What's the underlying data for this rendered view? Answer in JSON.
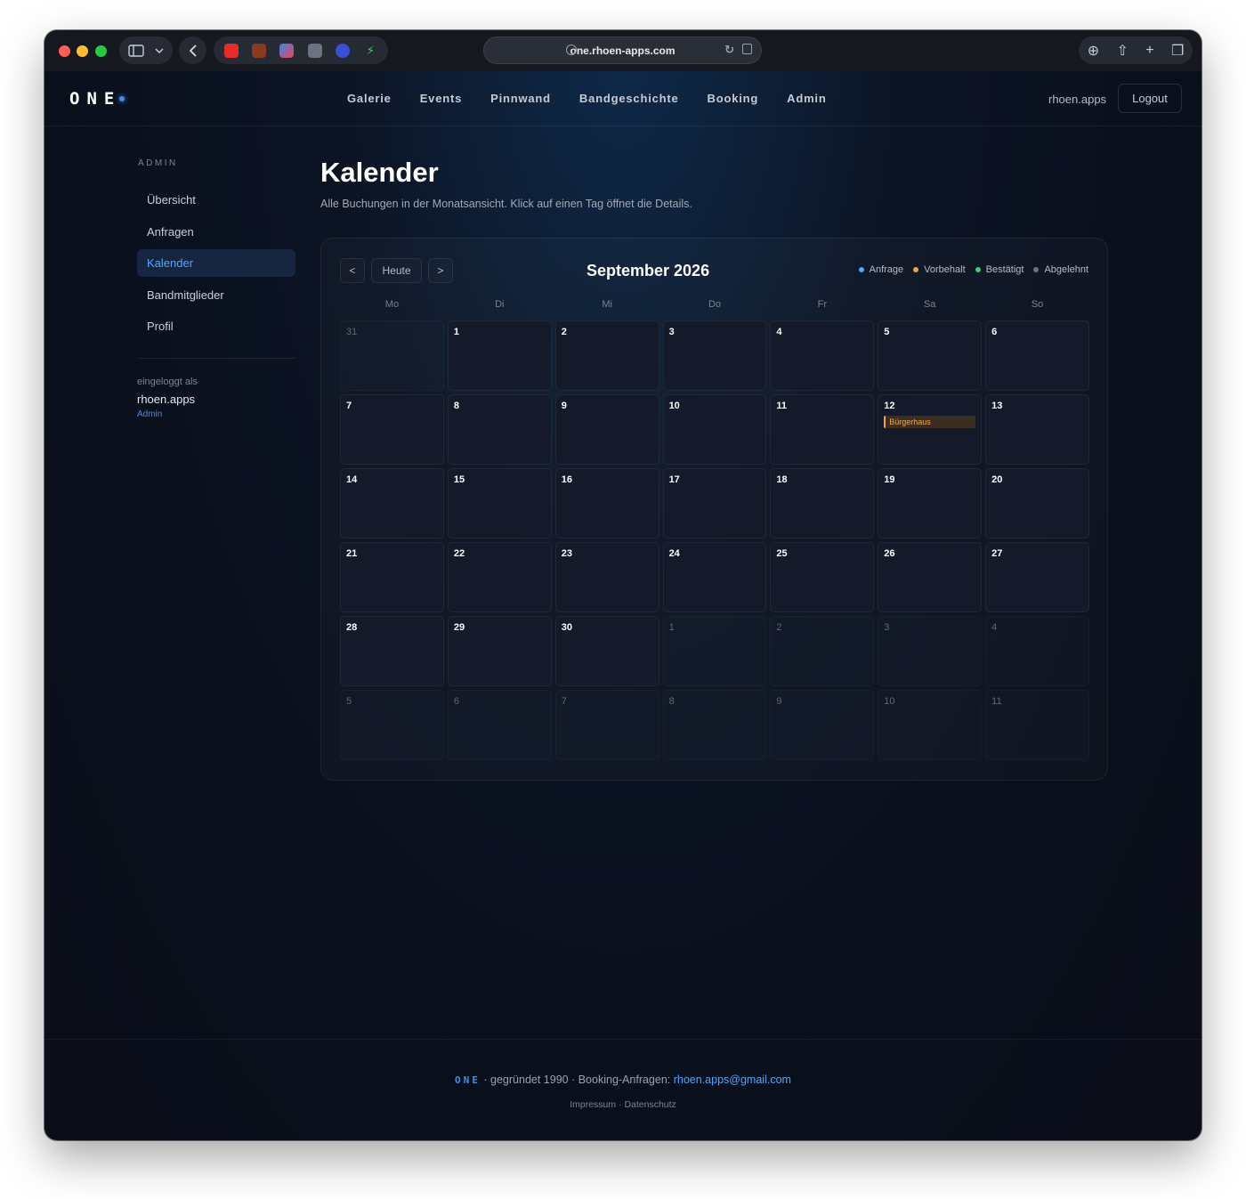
{
  "browser": {
    "url": "one.rhoen-apps.com",
    "extension_icons": [
      "youtube-icon",
      "asterisk-icon",
      "stack-icon",
      "e-icon",
      "shield-icon",
      "bolt-icon"
    ]
  },
  "site": {
    "logo": "ONE",
    "nav": [
      "Galerie",
      "Events",
      "Pinnwand",
      "Bandgeschichte",
      "Booking",
      "Admin"
    ],
    "user": "rhoen.apps",
    "logout": "Logout"
  },
  "sidebar": {
    "heading": "ADMIN",
    "items": [
      {
        "label": "Übersicht"
      },
      {
        "label": "Anfragen"
      },
      {
        "label": "Kalender"
      },
      {
        "label": "Bandmitglieder"
      },
      {
        "label": "Profil"
      }
    ],
    "login_label": "eingeloggt als",
    "login_user": "rhoen.apps",
    "login_role": "Admin"
  },
  "main": {
    "title": "Kalender",
    "subtitle": "Alle Buchungen in der Monatsansicht. Klick auf einen Tag öffnet die Details."
  },
  "calendar": {
    "prev": "<",
    "today": "Heute",
    "next": ">",
    "month": "September 2026",
    "legend": [
      {
        "label": "Anfrage",
        "color": "#4ea6ff"
      },
      {
        "label": "Vorbehalt",
        "color": "#f0a53c"
      },
      {
        "label": "Bestätigt",
        "color": "#3fcf6e"
      },
      {
        "label": "Abgelehnt",
        "color": "#6b7280"
      }
    ],
    "weekdays": [
      "Mo",
      "Di",
      "Mi",
      "Do",
      "Fr",
      "Sa",
      "So"
    ],
    "days": [
      {
        "n": "31",
        "other": true
      },
      {
        "n": "1"
      },
      {
        "n": "2"
      },
      {
        "n": "3"
      },
      {
        "n": "4"
      },
      {
        "n": "5"
      },
      {
        "n": "6"
      },
      {
        "n": "7"
      },
      {
        "n": "8"
      },
      {
        "n": "9"
      },
      {
        "n": "10"
      },
      {
        "n": "11"
      },
      {
        "n": "12",
        "event": "Bürgerhaus"
      },
      {
        "n": "13"
      },
      {
        "n": "14"
      },
      {
        "n": "15"
      },
      {
        "n": "16"
      },
      {
        "n": "17"
      },
      {
        "n": "18"
      },
      {
        "n": "19"
      },
      {
        "n": "20"
      },
      {
        "n": "21"
      },
      {
        "n": "22"
      },
      {
        "n": "23"
      },
      {
        "n": "24"
      },
      {
        "n": "25"
      },
      {
        "n": "26"
      },
      {
        "n": "27"
      },
      {
        "n": "28"
      },
      {
        "n": "29"
      },
      {
        "n": "30"
      },
      {
        "n": "1",
        "other": true
      },
      {
        "n": "2",
        "other": true
      },
      {
        "n": "3",
        "other": true
      },
      {
        "n": "4",
        "other": true
      },
      {
        "n": "5",
        "other": true
      },
      {
        "n": "6",
        "other": true
      },
      {
        "n": "7",
        "other": true
      },
      {
        "n": "8",
        "other": true
      },
      {
        "n": "9",
        "other": true
      },
      {
        "n": "10",
        "other": true
      },
      {
        "n": "11",
        "other": true
      }
    ]
  },
  "footer": {
    "logo": "ONE",
    "text": " · gegründet 1990 · Booking-Anfragen: ",
    "email": "rhoen.apps@gmail.com",
    "links": "Impressum · Datenschutz"
  }
}
